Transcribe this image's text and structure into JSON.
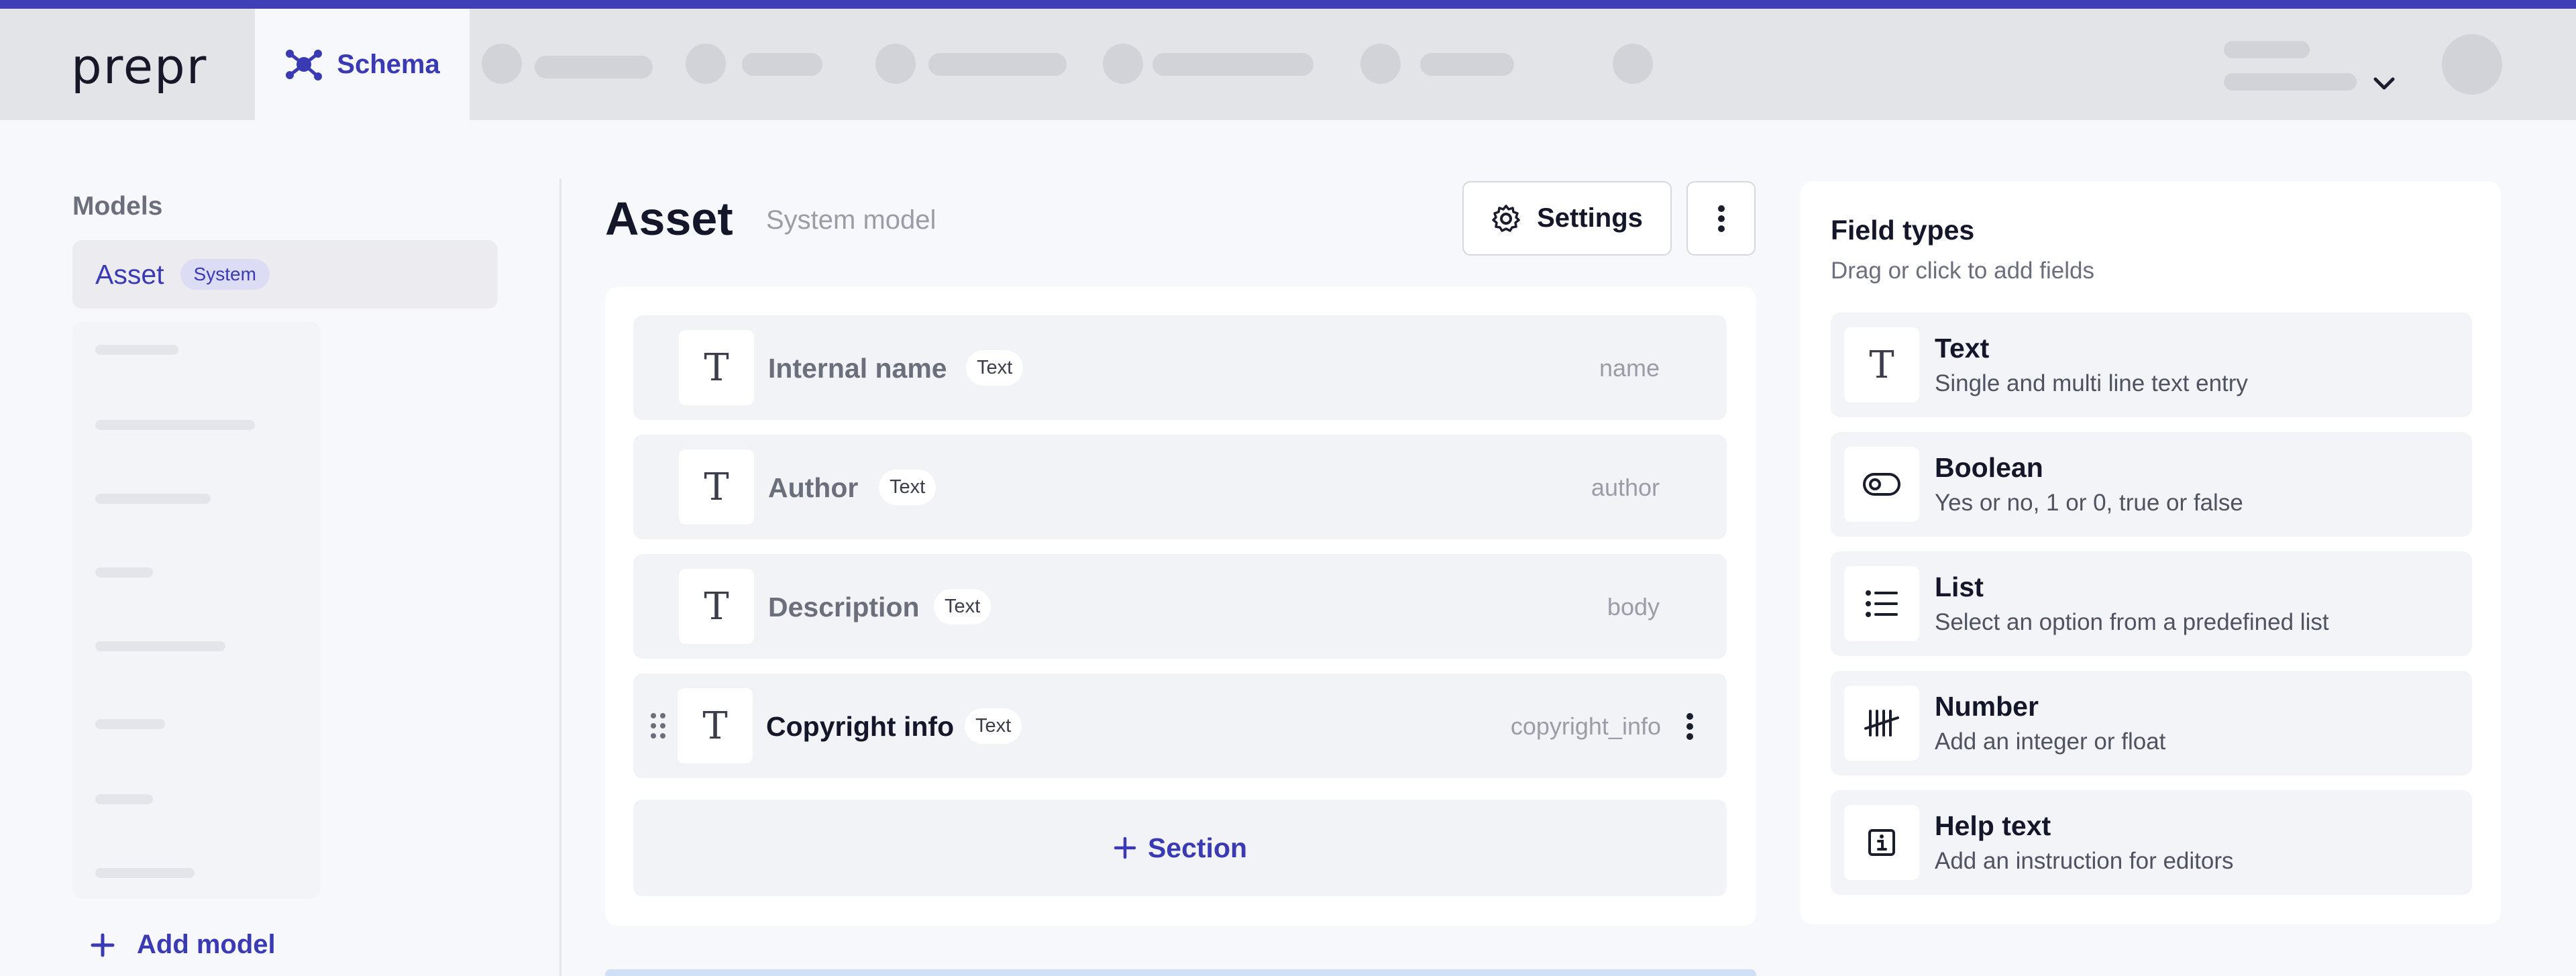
{
  "header": {
    "logo_text": "prepr",
    "active_tab_label": "Schema"
  },
  "sidebar": {
    "heading": "Models",
    "selected_model": {
      "label": "Asset",
      "badge": "System"
    },
    "add_model_label": "Add model"
  },
  "main": {
    "title": "Asset",
    "subtitle": "System model",
    "settings_label": "Settings",
    "fields": [
      {
        "name": "Internal name",
        "type_tag": "Text",
        "api_key": "name",
        "icon": "text-icon"
      },
      {
        "name": "Author",
        "type_tag": "Text",
        "api_key": "author",
        "icon": "text-icon"
      },
      {
        "name": "Description",
        "type_tag": "Text",
        "api_key": "body",
        "icon": "text-icon"
      },
      {
        "name": "Copyright info",
        "type_tag": "Text",
        "api_key": "copyright_info",
        "icon": "text-icon"
      }
    ],
    "add_section_label": "Section"
  },
  "field_types": {
    "title": "Field types",
    "subtitle": "Drag or click to add fields",
    "items": [
      {
        "name": "Text",
        "description": "Single and multi line text entry",
        "icon": "text-icon"
      },
      {
        "name": "Boolean",
        "description": "Yes or no, 1 or 0, true or false",
        "icon": "toggle-icon"
      },
      {
        "name": "List",
        "description": "Select an option from a predefined list",
        "icon": "list-icon"
      },
      {
        "name": "Number",
        "description": "Add an integer or float",
        "icon": "tally-icon"
      },
      {
        "name": "Help text",
        "description": "Add an instruction for editors",
        "icon": "info-icon"
      }
    ]
  },
  "colors": {
    "accent": "#3b3ab5",
    "top_line": "#3f3fb8",
    "header_bg": "#e3e4e8",
    "page_bg": "#f7f8fb"
  }
}
